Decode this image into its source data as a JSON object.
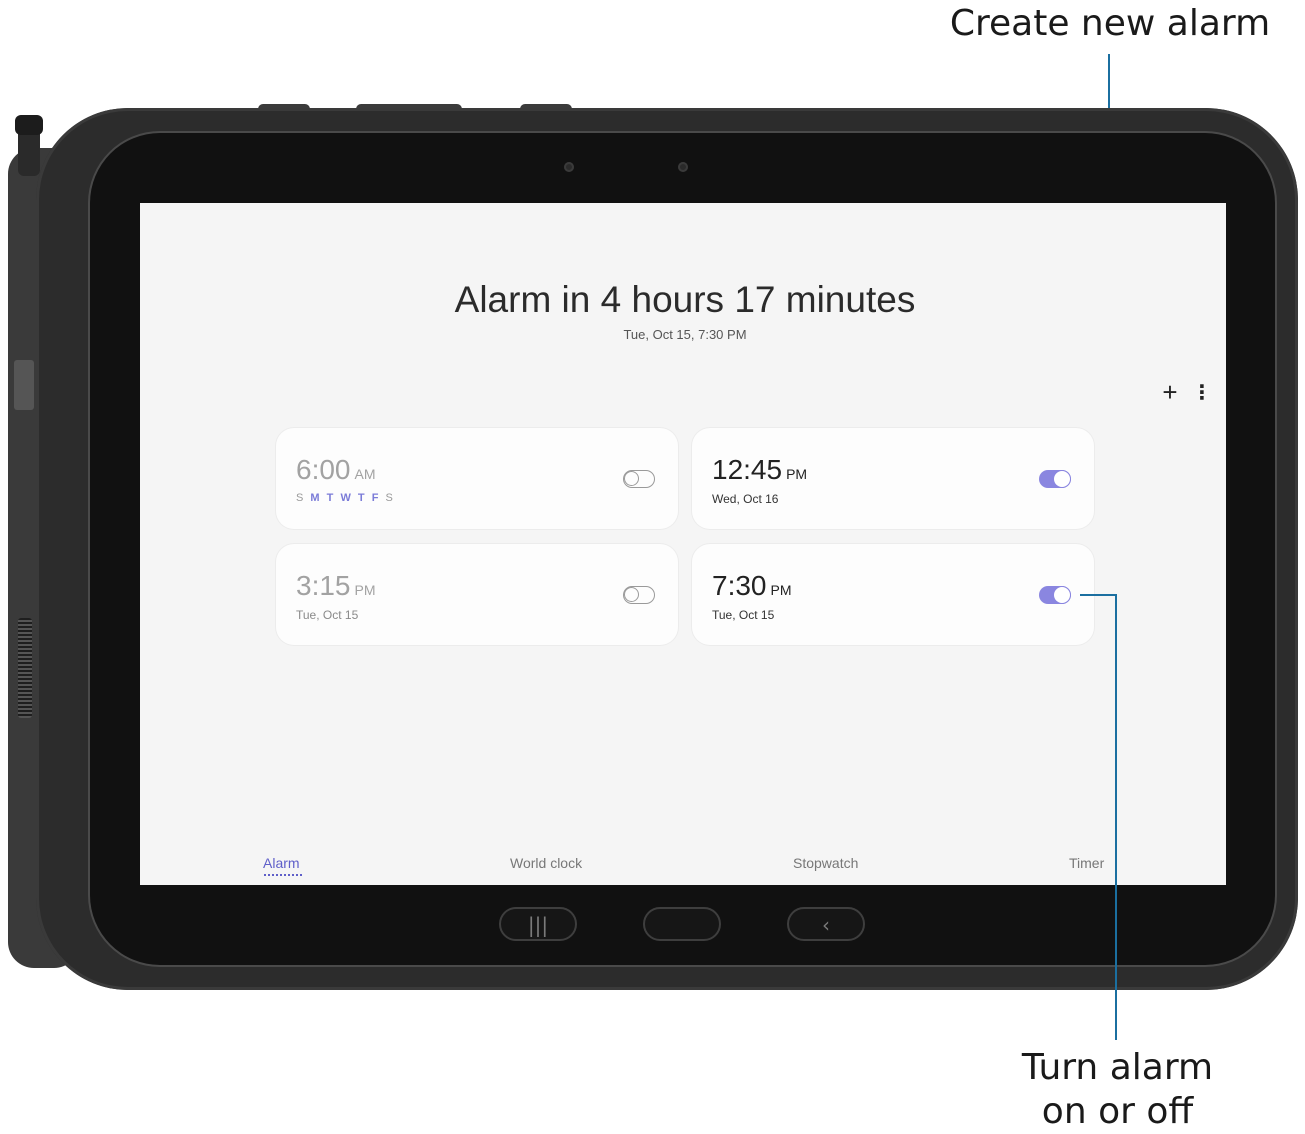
{
  "callouts": {
    "create_new_alarm": "Create new alarm",
    "turn_alarm_line1": "Turn alarm",
    "turn_alarm_line2": "on or off"
  },
  "screen": {
    "headline": "Alarm in 4 hours 17 minutes",
    "subhead": "Tue, Oct 15, 7:30 PM",
    "toolbar": {
      "add_icon": "+",
      "more_icon": "⋮"
    },
    "alarms": [
      {
        "time": "6:00",
        "ampm": "AM",
        "state": "off",
        "days": [
          {
            "label": "S",
            "active": false
          },
          {
            "label": "M",
            "active": true
          },
          {
            "label": "T",
            "active": true
          },
          {
            "label": "W",
            "active": true
          },
          {
            "label": "T",
            "active": true
          },
          {
            "label": "F",
            "active": true
          },
          {
            "label": "S",
            "active": false
          }
        ]
      },
      {
        "time": "12:45",
        "ampm": "PM",
        "date": "Wed, Oct 16",
        "state": "on"
      },
      {
        "time": "3:15",
        "ampm": "PM",
        "date": "Tue, Oct 15",
        "state": "off"
      },
      {
        "time": "7:30",
        "ampm": "PM",
        "date": "Tue, Oct 15",
        "state": "on"
      }
    ],
    "tabs": [
      {
        "label": "Alarm",
        "active": true
      },
      {
        "label": "World clock",
        "active": false
      },
      {
        "label": "Stopwatch",
        "active": false
      },
      {
        "label": "Timer",
        "active": false
      }
    ]
  },
  "device_keys": {
    "recents_icon": "|||",
    "back_icon": "‹"
  },
  "colors": {
    "accent": "#8a86e0",
    "callout_line": "#1b6fa0",
    "tab_active": "#5f5fc9"
  }
}
